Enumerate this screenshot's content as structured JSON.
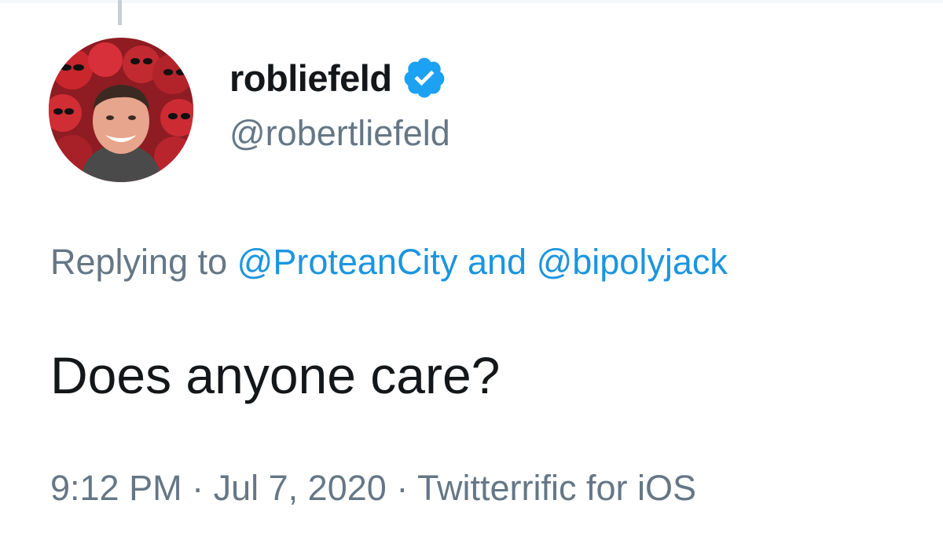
{
  "tweet": {
    "author": {
      "display_name": "robliefeld",
      "handle": "@robertliefeld",
      "verified": true,
      "avatar_icon": "profile-photo"
    },
    "reply": {
      "prefix": "Replying to",
      "mention_1": "@ProteanCity",
      "conjunction": "and",
      "mention_2": "@bipolyjack"
    },
    "text": "Does anyone care?",
    "meta": {
      "time": "9:12 PM",
      "separator": "·",
      "date": "Jul 7, 2020",
      "source": "Twitterrific for iOS"
    }
  },
  "colors": {
    "text_primary": "#14171a",
    "text_secondary": "#657786",
    "link": "#1b95e0",
    "verified_badge": "#1da1f2",
    "thread_line": "#c4cfd6"
  }
}
